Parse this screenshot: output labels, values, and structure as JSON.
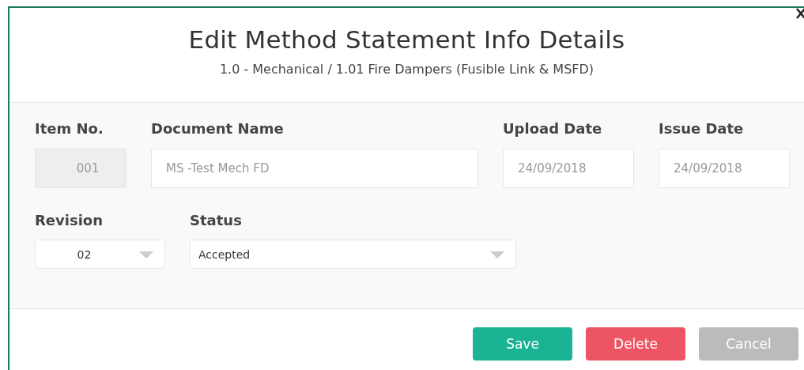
{
  "dialog": {
    "title": "Edit Method Statement Info Details",
    "subtitle": "1.0 - Mechanical / 1.01 Fire Dampers (Fusible Link & MSFD)"
  },
  "rows": [
    {
      "fields": [
        {
          "label": "Item No.",
          "kind": "text",
          "placeholder": "001",
          "disabled": true
        },
        {
          "label": "Document Name",
          "kind": "text",
          "placeholder": "MS -Test Mech FD",
          "disabled": false
        },
        {
          "label": "Upload Date",
          "kind": "text",
          "placeholder": "24/09/2018",
          "disabled": false
        },
        {
          "label": "Issue Date",
          "kind": "text",
          "placeholder": "24/09/2018",
          "disabled": false
        }
      ]
    },
    {
      "fields": [
        {
          "label": "Revision",
          "kind": "select",
          "value": "02",
          "disabled": false
        },
        {
          "label": "Status",
          "kind": "select",
          "value": "Accepted",
          "disabled": false
        }
      ]
    }
  ],
  "buttons": [
    {
      "label": "Save",
      "kind": "primary"
    },
    {
      "label": "Delete",
      "kind": "danger"
    },
    {
      "label": "Cancel",
      "kind": "neutral"
    }
  ]
}
